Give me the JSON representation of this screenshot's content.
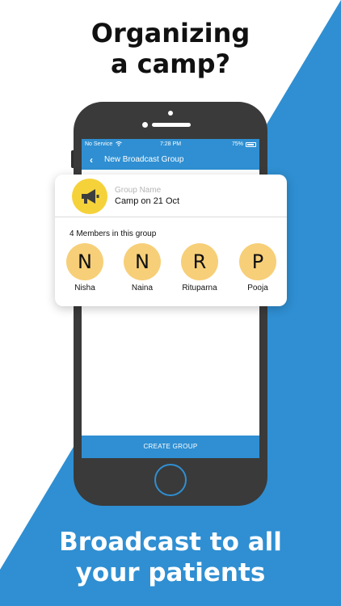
{
  "headline": {
    "line1": "Organizing",
    "line2": "a camp?"
  },
  "footer": {
    "line1": "Broadcast to all",
    "line2": "your patients"
  },
  "colors": {
    "accent": "#2f8fd2",
    "broadcast_avatar": "#f5d23a",
    "member_avatar": "#f7cf78"
  },
  "status_bar": {
    "carrier": "No Service",
    "time": "7:28 PM",
    "battery": "75%"
  },
  "app_bar": {
    "back_icon": "chevron-left-icon",
    "title": "New Broadcast Group"
  },
  "group": {
    "avatar_icon": "megaphone-icon",
    "name_label": "Group Name",
    "name_value": "Camp on 21 Oct"
  },
  "members": {
    "title": "4 Members in this group",
    "items": [
      {
        "initial": "N",
        "name": "Nisha"
      },
      {
        "initial": "N",
        "name": "Naina"
      },
      {
        "initial": "R",
        "name": "Rituparna"
      },
      {
        "initial": "P",
        "name": "Pooja"
      }
    ]
  },
  "actions": {
    "create_label": "CREATE GROUP"
  }
}
